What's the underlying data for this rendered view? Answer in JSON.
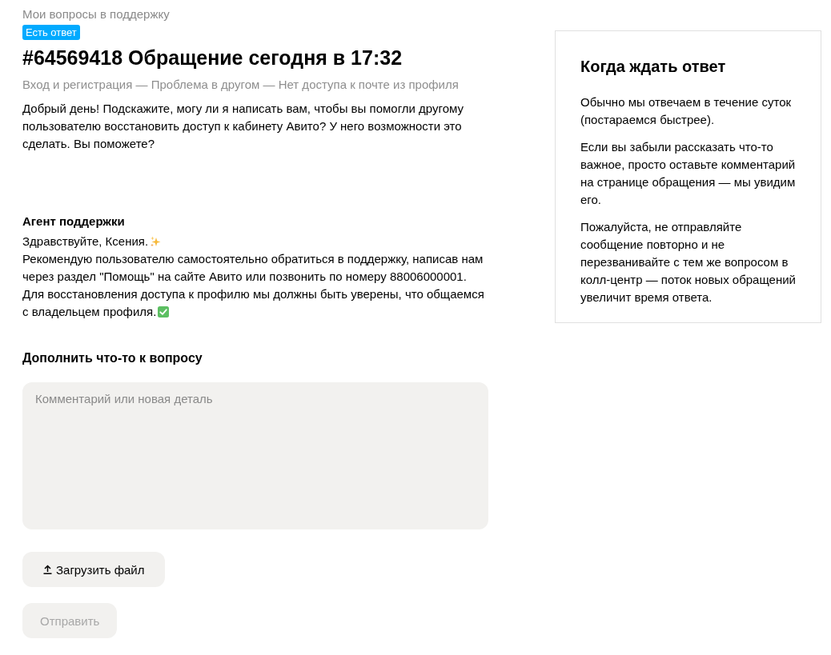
{
  "breadcrumb": "Мои вопросы в поддержку",
  "ticket": {
    "status_badge": "Есть ответ",
    "title": "#64569418 Обращение сегодня в 17:32",
    "category_path": "Вход и регистрация — Проблема в другом — Нет доступа к почте из профиля",
    "question": "Добрый день! Подскажите, могу ли я написать вам, чтобы вы помогли другому пользователю восстановить доступ к кабинету Авито? У него возможности это сделать. Вы поможете?"
  },
  "reply": {
    "author": "Агент поддержки",
    "lines": [
      {
        "text": "Здравствуйте, Ксения.",
        "kind": "sparkles"
      },
      {
        "text": "Рекомендую пользователю самостоятельно обратиться в поддержку, написав нам через раздел \"Помощь\" на сайте Авито или позвонить по номеру 88006000001.",
        "kind": "plain"
      },
      {
        "text": "Для восстановления доступа к профилю мы должны быть уверены, что общаемся",
        "kind": "plain"
      },
      {
        "text": "с владельцем профиля.",
        "kind": "check"
      }
    ]
  },
  "addition_form": {
    "heading": "Дополнить что-то к вопросу",
    "comment_field": {
      "placeholder": "Комментарий или новая деталь"
    },
    "buttons": [
      {
        "label": "Загрузить файл",
        "kind": "upload",
        "disabled": false
      },
      {
        "label": "Отправить",
        "kind": "submit",
        "disabled": true
      }
    ]
  },
  "info_card": {
    "title": "Когда ждать ответ",
    "paragraphs": [
      "Обычно мы отвечаем в течение суток (постараемся быстрее).",
      "Если вы забыли рассказать что-то важное, просто оставьте комментарий на странице обращения — мы увидим его.",
      "Пожалуйста, не отправляйте сообщение повторно и не перезванивайте с тем же вопросом в колл-центр — поток новых обращений увеличит время ответа."
    ]
  }
}
